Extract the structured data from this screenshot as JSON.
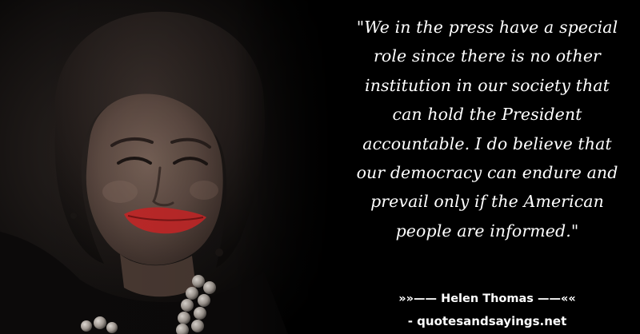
{
  "quote": {
    "text": "\"We in the press have a special role since there is no other institution in our society that can hold the President accountable. I do believe that our democracy can endure and prevail only if the American people are informed.\"",
    "lines": [
      "\"We in the press have a special",
      "role since there is no other",
      "institution in our society that",
      "can hold the President",
      "accountable. I do believe that",
      "our democracy can endure and",
      "prevail only if the American",
      "people are informed.\""
    ]
  },
  "attribution": {
    "text": "»»—— Helen Thomas ——««"
  },
  "source": {
    "text": "- quotesandsayings.net"
  },
  "colors": {
    "background": "#000000",
    "text": "#ffffff",
    "lips": "#c22a2a"
  }
}
